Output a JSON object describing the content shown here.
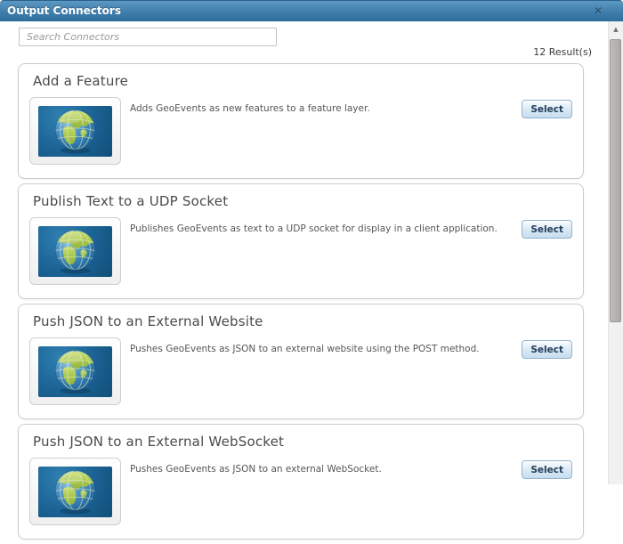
{
  "dialog": {
    "title": "Output Connectors"
  },
  "icons": {
    "close": "✕",
    "scroll_up": "▲"
  },
  "search": {
    "placeholder": "Search Connectors",
    "value": ""
  },
  "results_count": "12 Result(s)",
  "connectors": [
    {
      "title": "Add a Feature",
      "description": "Adds GeoEvents as new features to a feature layer.",
      "select_label": "Select"
    },
    {
      "title": "Publish Text to a UDP Socket",
      "description": "Publishes GeoEvents as text to a UDP socket for display in a client application.",
      "select_label": "Select"
    },
    {
      "title": "Push JSON to an External Website",
      "description": "Pushes GeoEvents as JSON to an external website using the POST method.",
      "select_label": "Select"
    },
    {
      "title": "Push JSON to an External WebSocket",
      "description": "Pushes GeoEvents as JSON to an external WebSocket.",
      "select_label": "Select"
    }
  ],
  "colors": {
    "titlebar_top": "#5b98c2",
    "titlebar_bottom": "#2e6d9d",
    "card_border": "#cbcbcb",
    "button_border": "#93b2cc",
    "button_fill": "#c6ddef",
    "thumb_ocean": "#2f80b1",
    "thumb_land": "#a9c94e"
  }
}
